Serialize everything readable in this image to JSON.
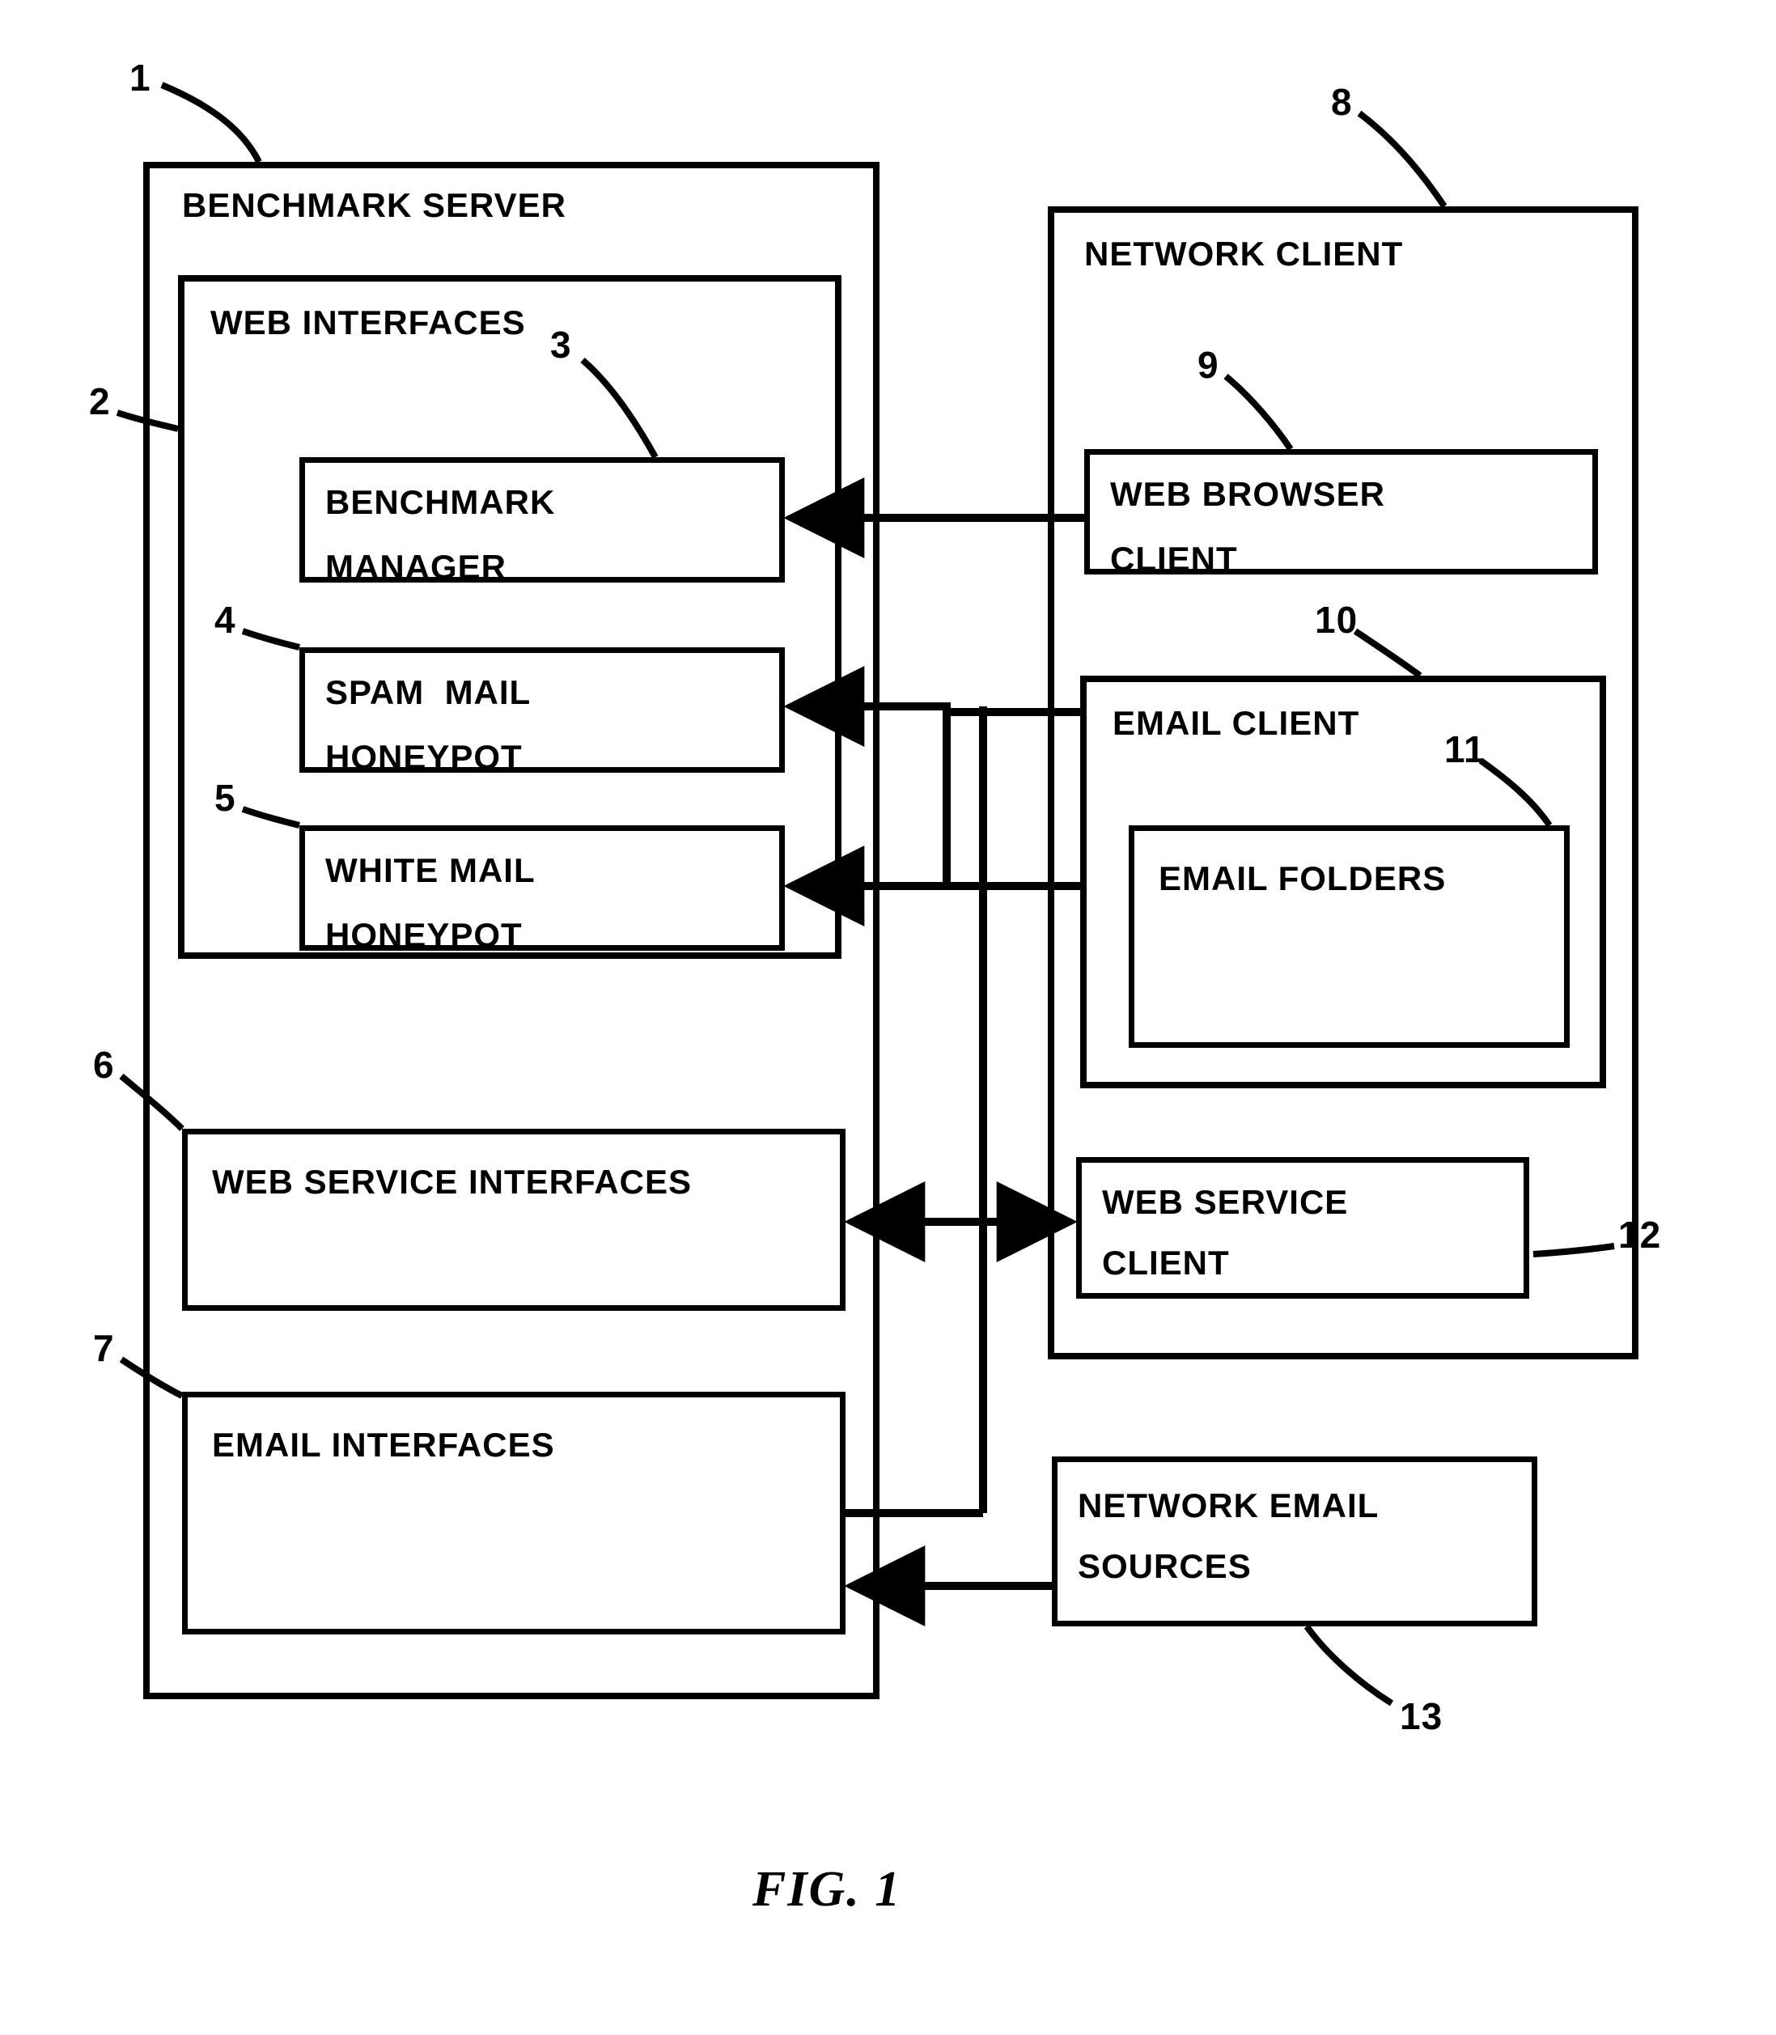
{
  "figure_label": "FIG. 1",
  "benchmark_server": {
    "title": "BENCHMARK SERVER",
    "ref": "1",
    "web_interfaces": {
      "title": "WEB INTERFACES",
      "ref": "2",
      "benchmark_manager": {
        "line1": "BENCHMARK",
        "line2": "MANAGER",
        "ref": "3"
      },
      "spam_mail_honeypot": {
        "line1": "SPAM  MAIL",
        "line2": "HONEYPOT",
        "ref": "4"
      },
      "white_mail_honeypot": {
        "line1": "WHITE MAIL",
        "line2": "HONEYPOT",
        "ref": "5"
      }
    },
    "web_service_interfaces": {
      "title": "WEB SERVICE INTERFACES",
      "ref": "6"
    },
    "email_interfaces": {
      "title": "EMAIL INTERFACES",
      "ref": "7"
    }
  },
  "network_client": {
    "title": "NETWORK CLIENT",
    "ref": "8",
    "web_browser_client": {
      "line1": "WEB BROWSER",
      "line2": "CLIENT",
      "ref": "9"
    },
    "email_client": {
      "title": "EMAIL CLIENT",
      "ref": "10",
      "email_folders": {
        "title": "EMAIL FOLDERS",
        "ref": "11"
      }
    },
    "web_service_client": {
      "line1": "WEB SERVICE",
      "line2": "CLIENT",
      "ref": "12"
    }
  },
  "network_email_sources": {
    "line1": "NETWORK EMAIL",
    "line2": "SOURCES",
    "ref": "13"
  }
}
